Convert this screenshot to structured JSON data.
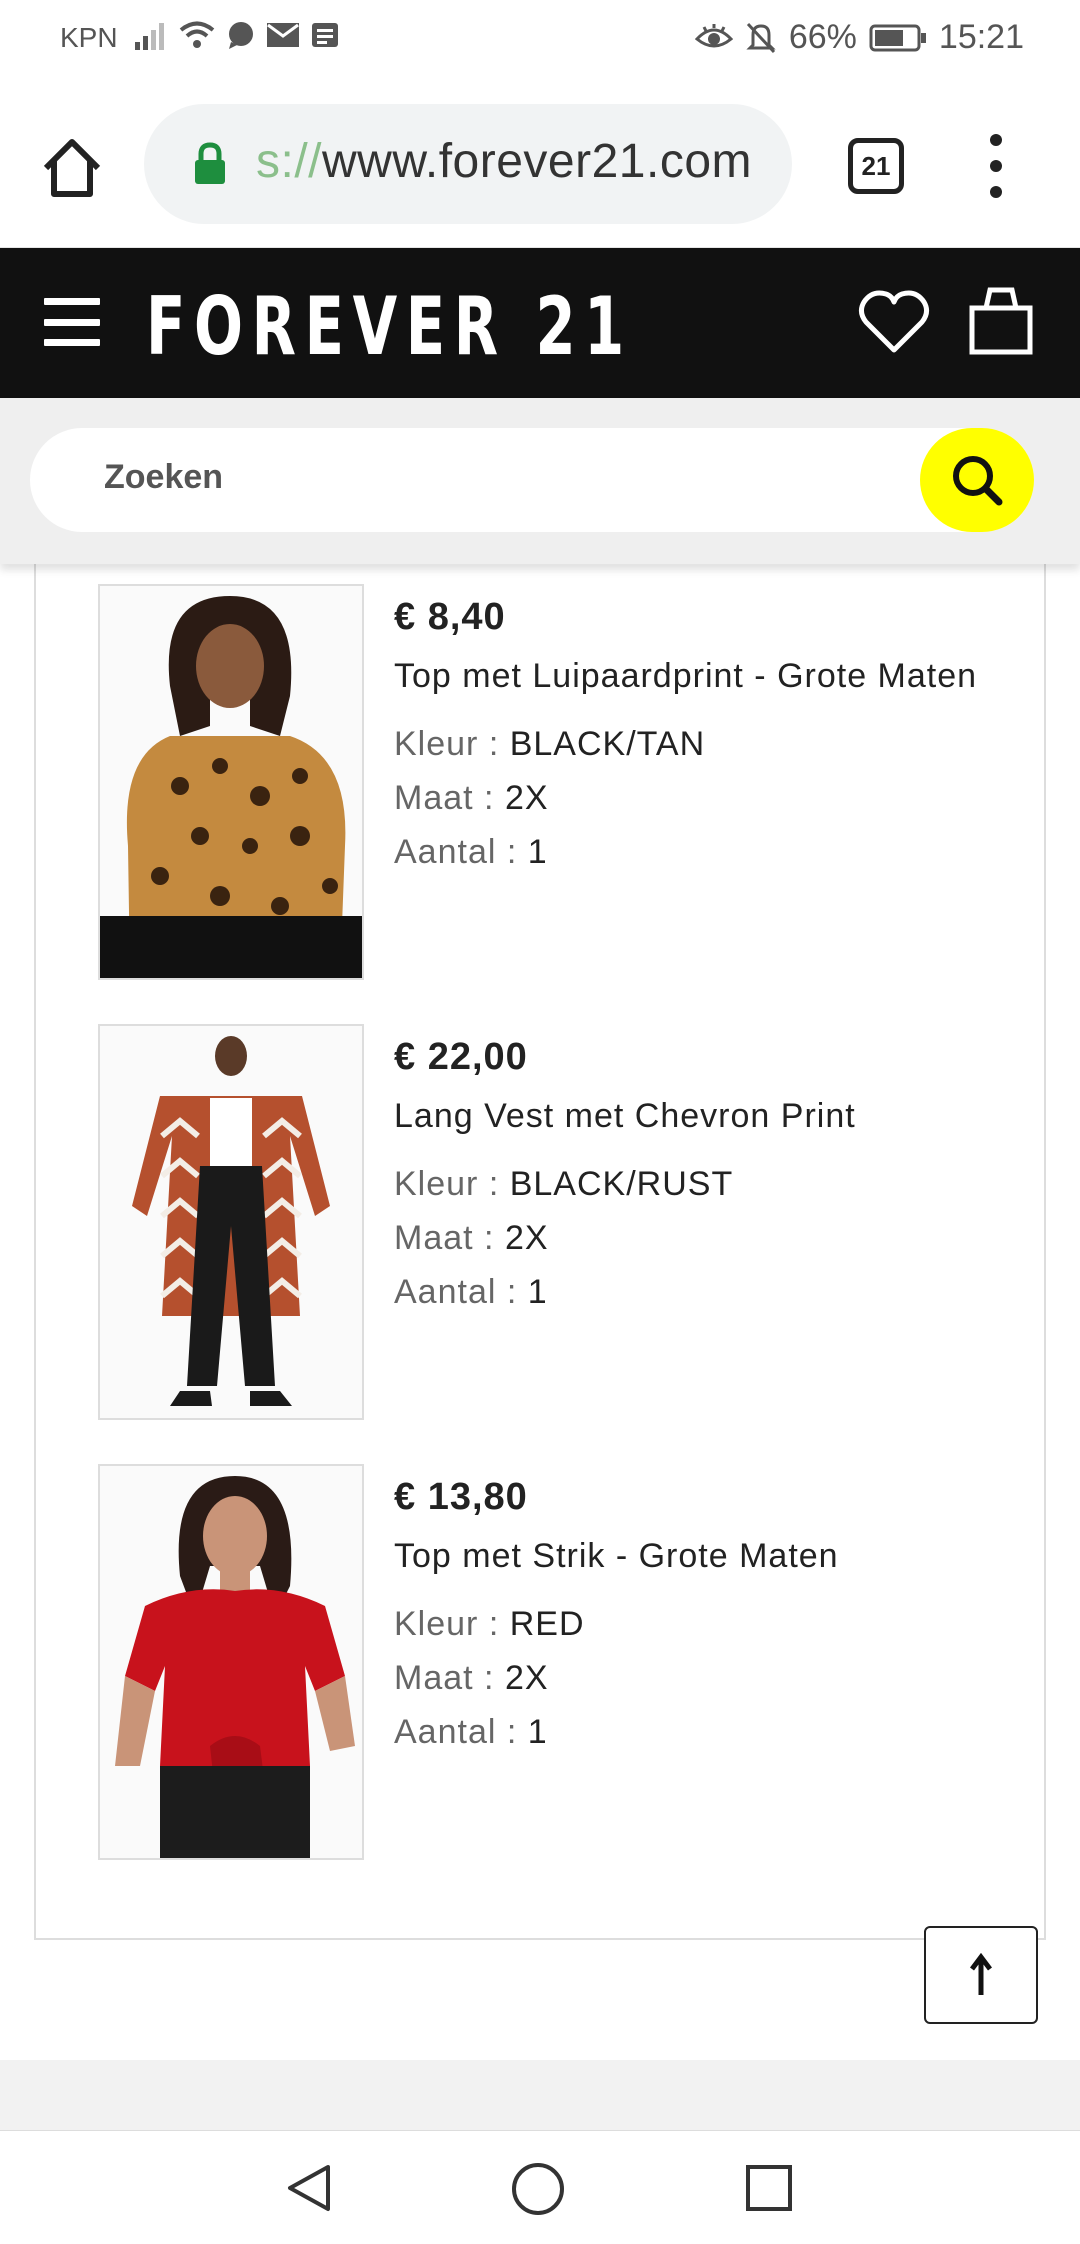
{
  "status_bar": {
    "carrier": "KPN",
    "battery": "66%",
    "time": "15:21"
  },
  "browser": {
    "url_scheme": "s://",
    "url_host": "www.forever21.com",
    "tab_count": "21"
  },
  "site": {
    "brand": "FOREVER 21",
    "search_placeholder": "Zoeken"
  },
  "labels": {
    "color": "Kleur : ",
    "size": "Maat : ",
    "qty": "Aantal : "
  },
  "items": [
    {
      "price": "€ 8,40",
      "name": "Top met Luipaardprint - Grote Maten",
      "color": "BLACK/TAN",
      "size": "2X",
      "qty": "1"
    },
    {
      "price": "€ 22,00",
      "name": "Lang Vest met Chevron Print",
      "color": "BLACK/RUST",
      "size": "2X",
      "qty": "1"
    },
    {
      "price": "€ 13,80",
      "name": "Top met Strik - Grote Maten",
      "color": "RED",
      "size": "2X",
      "qty": "1"
    }
  ],
  "colors": {
    "header_bg": "#111111",
    "search_button": "#ffff00",
    "lock": "#1e8e3e"
  }
}
